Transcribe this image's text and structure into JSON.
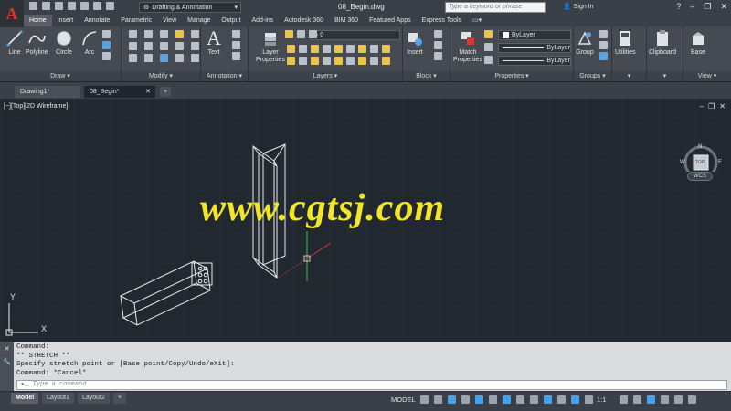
{
  "titlebar": {
    "logo": "A",
    "workspace": "Drafting & Annotation",
    "doc_title": "08_Begin.dwg",
    "search_placeholder": "Type a keyword or phrase",
    "signin": "Sign In"
  },
  "ribbon_tabs": [
    "Home",
    "Insert",
    "Annotate",
    "Parametric",
    "View",
    "Manage",
    "Output",
    "Add-ins",
    "Autodesk 360",
    "BIM 360",
    "Featured Apps",
    "Express Tools"
  ],
  "active_ribbon_tab": "Home",
  "panels": {
    "draw": {
      "label": "Draw",
      "tools": [
        "Line",
        "Polyline",
        "Circle",
        "Arc"
      ]
    },
    "modify": {
      "label": "Modify"
    },
    "annotation": {
      "label": "Annotation",
      "tools": [
        "Text"
      ]
    },
    "layers": {
      "label": "Layers",
      "tools": [
        "Layer Properties"
      ],
      "current_layer": "0"
    },
    "block": {
      "label": "Block",
      "tools": [
        "Insert"
      ]
    },
    "properties": {
      "label": "Properties",
      "tools": [
        "Match Properties"
      ],
      "color": "ByLayer",
      "linetype": "ByLayer",
      "lineweight": "ByLayer"
    },
    "groups": {
      "label": "Groups",
      "tools": [
        "Group"
      ]
    },
    "utilities": {
      "tools": [
        "Utilities"
      ]
    },
    "clipboard": {
      "tools": [
        "Clipboard"
      ]
    },
    "view": {
      "label": "View",
      "tools": [
        "Base"
      ]
    }
  },
  "doc_tabs": [
    "Drawing1*",
    "08_Begin*"
  ],
  "active_doc_tab": "08_Begin*",
  "viewport": {
    "label": "[−][Top][2D Wireframe]",
    "viewcube": {
      "top": "TOP",
      "n": "N",
      "s": "S",
      "e": "E",
      "w": "W"
    },
    "wcs": "WCS",
    "ucs": {
      "x": "X",
      "y": "Y"
    },
    "watermark": "www.cgtsj.com"
  },
  "command": {
    "history": [
      "Command:",
      "** STRETCH **",
      "Specify stretch point or [Base point/Copy/Undo/eXit]:",
      "Command: *Cancel*"
    ],
    "placeholder": "Type a command"
  },
  "layout_tabs": [
    "Model",
    "Layout1",
    "Layout2"
  ],
  "active_layout": "Model",
  "status": {
    "mode": "MODEL",
    "scale": "1:1"
  },
  "colors": {
    "canvas": "#212830",
    "ribbon": "#454a53",
    "watermark": "#f2e52a",
    "accent_red": "#d9372b"
  }
}
